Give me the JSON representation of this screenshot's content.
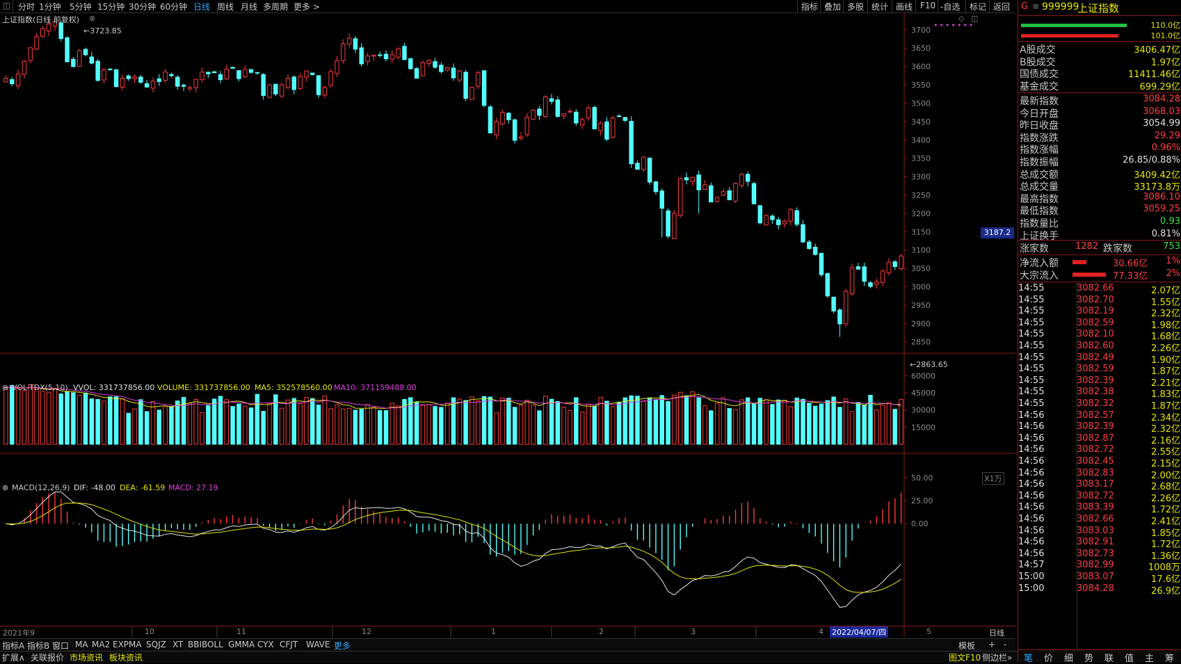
{
  "toolbar": {
    "tabs": [
      "分时",
      "1分钟",
      "5分钟",
      "15分钟",
      "30分钟",
      "60分钟",
      "日线",
      "周线",
      "月线",
      "多周期",
      "更多 >"
    ],
    "active_tab": "日线",
    "right_buttons": [
      "指标",
      "叠加",
      "多股",
      "统计",
      "画线",
      "F10",
      "-自选",
      "标记",
      "返回"
    ]
  },
  "main_chart": {
    "title": "上证指数(日线 前复权)",
    "high_label": "3723.85",
    "low_label": "2863.65",
    "current_price_box": "3187.2",
    "y_ticks": [
      "3700",
      "3650",
      "3600",
      "3550",
      "3500",
      "3450",
      "3400",
      "3350",
      "3300",
      "3250",
      "3200",
      "3150",
      "3100",
      "3050",
      "3000",
      "2950",
      "2900",
      "2850"
    ]
  },
  "volume_chart": {
    "name": "VOL-TDX(5,10)",
    "vvol": "VVOL: 331737856.00",
    "volume": "VOLUME: 331737856.00",
    "ma5": "MA5: 352578560.00",
    "ma10": "MA10: 371159488.00",
    "y_ticks": [
      "60000",
      "45000",
      "30000",
      "15000"
    ],
    "unit": "X1万"
  },
  "macd_chart": {
    "name": "MACD(12,26,9)",
    "dif": "DIF: -48.00",
    "dea": "DEA: -61.59",
    "macd": "MACD: 27.19",
    "y_ticks": [
      "50.00",
      "25.00",
      "0.00"
    ]
  },
  "x_axis": {
    "labels": [
      "2021年9",
      "10",
      "11",
      "12",
      "1",
      "2",
      "3",
      "4",
      "5"
    ],
    "cursor_date": "2022/04/07/四",
    "period": "日线"
  },
  "indicator_tabs": [
    "指标A",
    "指标B",
    "窗口",
    "MA",
    "MA2",
    "EXPMA",
    "SQJZ",
    "XT",
    "BBIBOLL",
    "GMMA",
    "CYX",
    "CFJT",
    "WAVE",
    "更多"
  ],
  "indicator_right": [
    "模板",
    "+",
    "-"
  ],
  "status_bar": {
    "items": [
      "扩展∧",
      "关联报价",
      "市场资讯",
      "板块资讯"
    ],
    "right": [
      "图文F10",
      "侧边栏»"
    ]
  },
  "quote": {
    "flag": "G",
    "code": "999999",
    "name": "上证指数",
    "bar1_value": "110.0亿",
    "bar2_value": "101.0亿",
    "rows_a": [
      {
        "k": "A股成交",
        "v": "3406.47亿",
        "c": "#e8e800"
      },
      {
        "k": "B股成交",
        "v": "1.97亿",
        "c": "#e8e800"
      },
      {
        "k": "国债成交",
        "v": "11411.46亿",
        "c": "#e8e800"
      },
      {
        "k": "基金成交",
        "v": "699.29亿",
        "c": "#e8e800"
      }
    ],
    "rows_b": [
      {
        "k": "最新指数",
        "v": "3084.28",
        "c": "#ff4040"
      },
      {
        "k": "今日开盘",
        "v": "3068.03",
        "c": "#ff4040"
      },
      {
        "k": "昨日收盘",
        "v": "3054.99",
        "c": "#e0e0e0"
      },
      {
        "k": "指数涨跌",
        "v": "29.29",
        "c": "#ff4040"
      },
      {
        "k": "指数涨幅",
        "v": "0.96%",
        "c": "#ff4040"
      },
      {
        "k": "指数振幅",
        "v": "26.85/0.88%",
        "c": "#e0e0e0"
      },
      {
        "k": "总成交额",
        "v": "3409.42亿",
        "c": "#e8e800"
      },
      {
        "k": "总成交量",
        "v": "33173.8万",
        "c": "#e8e800"
      },
      {
        "k": "最高指数",
        "v": "3086.10",
        "c": "#ff4040"
      },
      {
        "k": "最低指数",
        "v": "3059.25",
        "c": "#ff4040"
      },
      {
        "k": "指数量比",
        "v": "0.93",
        "c": "#40e040"
      },
      {
        "k": "上证换手",
        "v": "0.81%",
        "c": "#e0e0e0"
      }
    ],
    "up_label": "涨家数",
    "up_count": "1282",
    "down_label": "跌家数",
    "down_count": "753",
    "flow_rows": [
      {
        "k": "净流入额",
        "v": "30.66亿",
        "pct": "1%"
      },
      {
        "k": "大宗流入",
        "v": "77.33亿",
        "pct": "2%"
      }
    ]
  },
  "ticks": [
    {
      "t": "14:55",
      "p": "3082.66",
      "a": "2.07亿"
    },
    {
      "t": "14:55",
      "p": "3082.70",
      "a": "1.55亿"
    },
    {
      "t": "14:55",
      "p": "3082.19",
      "a": "2.32亿"
    },
    {
      "t": "14:55",
      "p": "3082.59",
      "a": "1.98亿"
    },
    {
      "t": "14:55",
      "p": "3082.10",
      "a": "1.68亿"
    },
    {
      "t": "14:55",
      "p": "3082.60",
      "a": "2.26亿"
    },
    {
      "t": "14:55",
      "p": "3082.49",
      "a": "1.90亿"
    },
    {
      "t": "14:55",
      "p": "3082.59",
      "a": "1.87亿"
    },
    {
      "t": "14:55",
      "p": "3082.39",
      "a": "2.21亿"
    },
    {
      "t": "14:55",
      "p": "3082.38",
      "a": "1.83亿"
    },
    {
      "t": "14:55",
      "p": "3082.32",
      "a": "1.87亿"
    },
    {
      "t": "14:56",
      "p": "3082.57",
      "a": "2.34亿"
    },
    {
      "t": "14:56",
      "p": "3082.39",
      "a": "2.32亿"
    },
    {
      "t": "14:56",
      "p": "3082.87",
      "a": "2.16亿"
    },
    {
      "t": "14:56",
      "p": "3082.72",
      "a": "2.55亿"
    },
    {
      "t": "14:56",
      "p": "3082.45",
      "a": "2.15亿"
    },
    {
      "t": "14:56",
      "p": "3082.83",
      "a": "2.00亿"
    },
    {
      "t": "14:56",
      "p": "3083.17",
      "a": "2.68亿"
    },
    {
      "t": "14:56",
      "p": "3082.72",
      "a": "2.26亿"
    },
    {
      "t": "14:56",
      "p": "3083.39",
      "a": "1.72亿"
    },
    {
      "t": "14:56",
      "p": "3082.66",
      "a": "2.41亿"
    },
    {
      "t": "14:56",
      "p": "3083.03",
      "a": "1.85亿"
    },
    {
      "t": "14:56",
      "p": "3082.91",
      "a": "1.72亿"
    },
    {
      "t": "14:56",
      "p": "3082.73",
      "a": "1.36亿"
    },
    {
      "t": "14:57",
      "p": "3082.99",
      "a": "1008万"
    },
    {
      "t": "15:00",
      "p": "3083.07",
      "a": "17.6亿"
    },
    {
      "t": "15:00",
      "p": "3084.28",
      "a": "26.9亿"
    }
  ],
  "bottom_tabs": [
    "笔",
    "价",
    "细",
    "势",
    "联",
    "值",
    "主",
    "筹"
  ],
  "chart_data": {
    "type": "candlestick",
    "closes": [
      3568,
      3553,
      3580,
      3614,
      3651,
      3681,
      3703,
      3716,
      3723,
      3676,
      3613,
      3600,
      3643,
      3632,
      3609,
      3562,
      3591,
      3592,
      3545,
      3568,
      3567,
      3572,
      3557,
      3544,
      3560,
      3559,
      3585,
      3575,
      3546,
      3546,
      3543,
      3565,
      3585,
      3580,
      3583,
      3564,
      3593,
      3595,
      3567,
      3592,
      3584,
      3582,
      3521,
      3550,
      3525,
      3550,
      3568,
      3537,
      3573,
      3588,
      3578,
      3523,
      3543,
      3586,
      3616,
      3662,
      3677,
      3647,
      3607,
      3629,
      3631,
      3630,
      3621,
      3632,
      3648,
      3619,
      3594,
      3568,
      3610,
      3617,
      3598,
      3586,
      3597,
      3569,
      3588,
      3513,
      3543,
      3583,
      3494,
      3419,
      3450,
      3475,
      3455,
      3399,
      3408,
      3462,
      3481,
      3467,
      3517,
      3505,
      3464,
      3471,
      3478,
      3446,
      3456,
      3487,
      3430,
      3446,
      3402,
      3460,
      3465,
      3453,
      3335,
      3320,
      3353,
      3285,
      3259,
      3214,
      3138,
      3200,
      3295,
      3291,
      3298,
      3264,
      3278,
      3231,
      3243,
      3259,
      3237,
      3282,
      3306,
      3287,
      3226,
      3174,
      3194,
      3183,
      3169,
      3179,
      3211,
      3170,
      3122,
      3104,
      3088,
      3033,
      2975,
      2934,
      2899,
      2988,
      3052,
      3048,
      3015,
      3001,
      3013,
      3043,
      3067,
      3055,
      3084
    ],
    "y_range": [
      2840,
      3730
    ],
    "volume_y_range": [
      0,
      70000
    ],
    "macd_y_range": [
      -110,
      65
    ]
  }
}
